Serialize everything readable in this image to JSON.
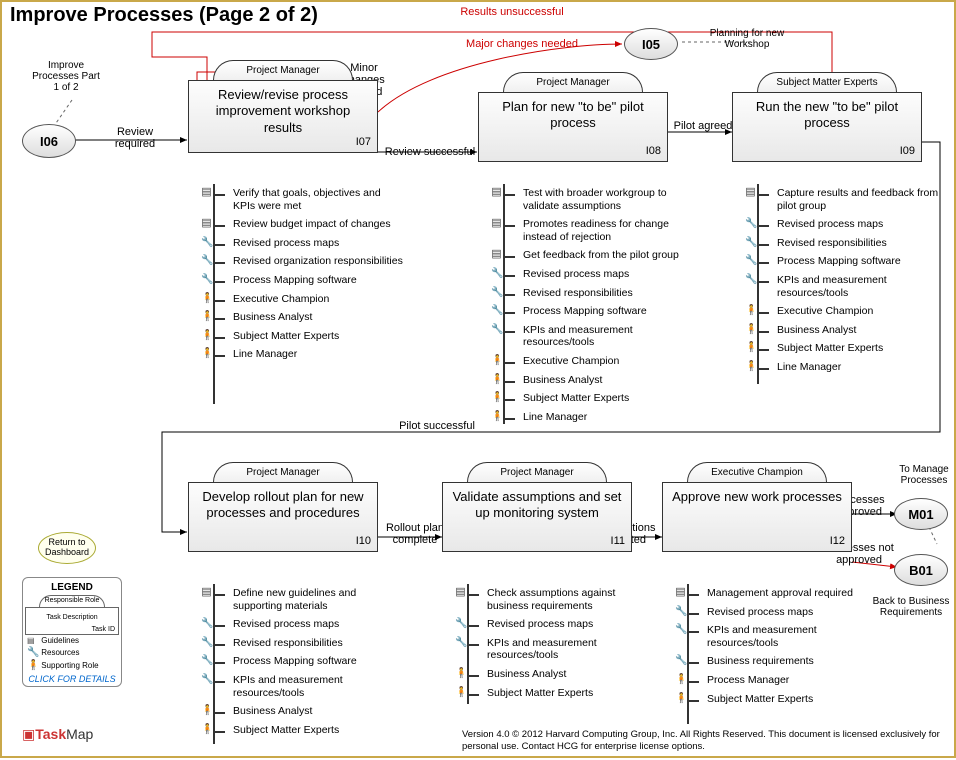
{
  "title": "Improve Processes (Page 2 of 2)",
  "labels": {
    "improve_part1": "Improve Processes Part 1 of 2",
    "review_required": "Review required",
    "minor_changes": "Minor changes needed",
    "major_changes": "Major changes needed",
    "results_unsuccessful": "Results unsuccessful",
    "review_successful": "Review successful",
    "planning_workshop": "Planning for new Workshop",
    "pilot_agreed": "Pilot agreed",
    "pilot_successful": "Pilot successful",
    "rollout_complete": "Rollout plan complete",
    "assumptions_validated": "Assumptions validated",
    "processes_approved": "Processes approved",
    "processes_not_approved": "Processes not approved",
    "to_manage": "To Manage Processes",
    "back_to_br": "Back to Business Requirements",
    "return_dash": "Return to Dashboard"
  },
  "nodes": {
    "I06": "I06",
    "I05": "I05",
    "M01": "M01",
    "B01": "B01"
  },
  "tasks": {
    "I07": {
      "role": "Project Manager",
      "desc": "Review/revise process improvement workshop results",
      "id": "I07"
    },
    "I08": {
      "role": "Project Manager",
      "desc": "Plan for new \"to be\" pilot process",
      "id": "I08"
    },
    "I09": {
      "role": "Subject Matter Experts",
      "desc": "Run the new \"to be\" pilot process",
      "id": "I09"
    },
    "I10": {
      "role": "Project Manager",
      "desc": "Develop rollout plan for new processes and procedures",
      "id": "I10"
    },
    "I11": {
      "role": "Project Manager",
      "desc": "Validate assumptions and set up monitoring system",
      "id": "I11"
    },
    "I12": {
      "role": "Executive Champion",
      "desc": "Approve new work processes",
      "id": "I12"
    }
  },
  "details": {
    "I07": [
      {
        "t": "doc",
        "txt": "Verify that goals, objectives and KPIs were met"
      },
      {
        "t": "doc",
        "txt": "Review budget impact of changes"
      },
      {
        "t": "wrench",
        "txt": "Revised process maps"
      },
      {
        "t": "wrench",
        "txt": "Revised organization responsibilities"
      },
      {
        "t": "wrench",
        "txt": "Process Mapping software"
      },
      {
        "t": "person",
        "txt": "Executive Champion"
      },
      {
        "t": "person",
        "txt": "Business Analyst"
      },
      {
        "t": "person",
        "txt": "Subject Matter Experts"
      },
      {
        "t": "person",
        "txt": "Line Manager"
      }
    ],
    "I08": [
      {
        "t": "doc",
        "txt": "Test with broader workgroup to validate assumptions"
      },
      {
        "t": "doc",
        "txt": "Promotes readiness for change instead of rejection"
      },
      {
        "t": "doc",
        "txt": "Get feedback from the pilot group"
      },
      {
        "t": "wrench",
        "txt": "Revised process maps"
      },
      {
        "t": "wrench",
        "txt": "Revised responsibilities"
      },
      {
        "t": "wrench",
        "txt": "Process Mapping software"
      },
      {
        "t": "wrench",
        "txt": "KPIs and measurement resources/tools"
      },
      {
        "t": "person",
        "txt": "Executive Champion"
      },
      {
        "t": "person",
        "txt": "Business Analyst"
      },
      {
        "t": "person",
        "txt": "Subject Matter Experts"
      },
      {
        "t": "person",
        "txt": "Line Manager"
      }
    ],
    "I09": [
      {
        "t": "doc",
        "txt": "Capture results and feedback from pilot group"
      },
      {
        "t": "wrench",
        "txt": "Revised process maps"
      },
      {
        "t": "wrench",
        "txt": "Revised responsibilities"
      },
      {
        "t": "wrench",
        "txt": "Process Mapping software"
      },
      {
        "t": "wrench",
        "txt": "KPIs and measurement resources/tools"
      },
      {
        "t": "person",
        "txt": "Executive Champion"
      },
      {
        "t": "person",
        "txt": "Business Analyst"
      },
      {
        "t": "person",
        "txt": "Subject Matter Experts"
      },
      {
        "t": "person",
        "txt": "Line Manager"
      }
    ],
    "I10": [
      {
        "t": "doc",
        "txt": "Define new guidelines and supporting materials"
      },
      {
        "t": "wrench",
        "txt": "Revised process maps"
      },
      {
        "t": "wrench",
        "txt": "Revised responsibilities"
      },
      {
        "t": "wrench",
        "txt": "Process Mapping software"
      },
      {
        "t": "wrench",
        "txt": "KPIs and measurement resources/tools"
      },
      {
        "t": "person",
        "txt": "Business Analyst"
      },
      {
        "t": "person",
        "txt": "Subject Matter Experts"
      }
    ],
    "I11": [
      {
        "t": "doc",
        "txt": "Check assumptions against business requirements"
      },
      {
        "t": "wrench",
        "txt": "Revised process maps"
      },
      {
        "t": "wrench",
        "txt": "KPIs and measurement resources/tools"
      },
      {
        "t": "person",
        "txt": "Business Analyst"
      },
      {
        "t": "person",
        "txt": "Subject Matter Experts"
      }
    ],
    "I12": [
      {
        "t": "doc",
        "txt": "Management approval required"
      },
      {
        "t": "wrench",
        "txt": "Revised process maps"
      },
      {
        "t": "wrench",
        "txt": "KPIs and measurement resources/tools"
      },
      {
        "t": "wrench",
        "txt": "Business requirements"
      },
      {
        "t": "person",
        "txt": "Process Manager"
      },
      {
        "t": "person",
        "txt": "Subject Matter Experts"
      }
    ]
  },
  "legend": {
    "header": "LEGEND",
    "role": "Responsible Role",
    "desc": "Task Description",
    "tid": "Task ID",
    "rows": [
      {
        "ic": "doc",
        "txt": "Guidelines"
      },
      {
        "ic": "wrench",
        "txt": "Resources"
      },
      {
        "ic": "person",
        "txt": "Supporting Role"
      }
    ],
    "click": "CLICK FOR DETAILS"
  },
  "footer": "Version 4.0   © 2012 Harvard Computing Group, Inc. All Rights Reserved. This document is licensed exclusively for personal use. Contact HCG for enterprise license options.",
  "taskmap": {
    "a": "Task",
    "b": "Map"
  }
}
